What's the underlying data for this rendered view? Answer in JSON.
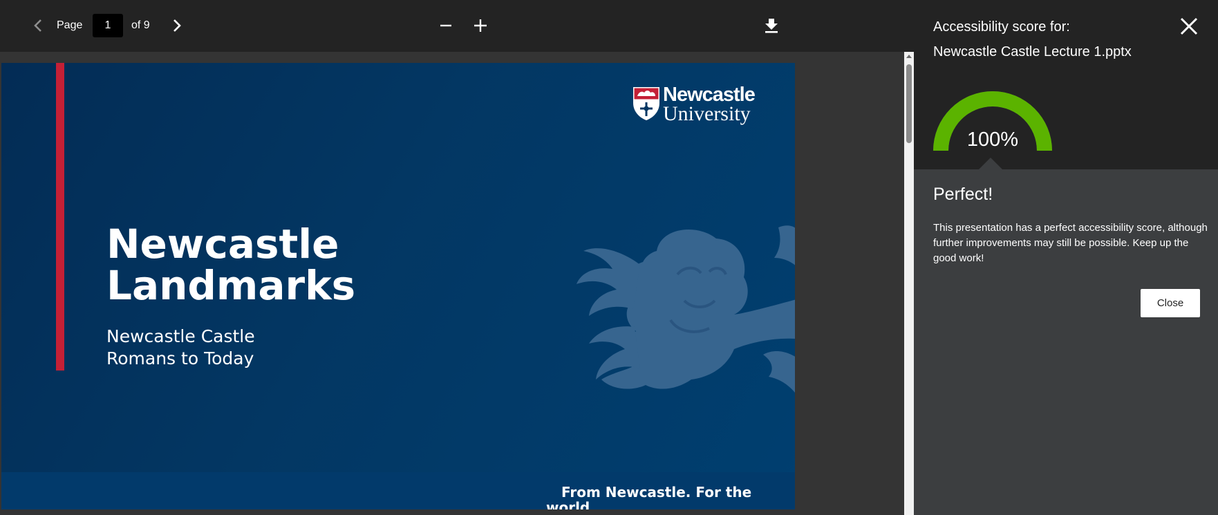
{
  "viewer": {
    "toolbar": {
      "prev_icon": "chevron-left-icon",
      "page_label": "Page",
      "page_value": "1",
      "of_label": "of 9",
      "next_icon": "chevron-right-icon",
      "zoom_out_icon": "minus-icon",
      "zoom_in_icon": "plus-icon",
      "download_icon": "download-icon"
    },
    "slide": {
      "logo_line1": "Newcastle",
      "logo_line2": "University",
      "title": "Newcastle\nLandmarks",
      "subtitle": "Newcastle Castle\nRomans to Today",
      "tagline": "From Newcastle. For the world."
    }
  },
  "panel": {
    "heading": "Accessibility score for:",
    "filename": "Newcastle Castle Lecture 1.pptx",
    "score": "100%",
    "score_fraction": 1.0,
    "result_title": "Perfect!",
    "result_body": "This presentation has a perfect accessibility score, although further improvements may still be possible. Keep up the good work!",
    "close_label": "Close",
    "close_icon": "close-icon"
  },
  "colors": {
    "gauge_fill": "#5bb300",
    "slide_accent": "#c42036",
    "slide_background": "#033763"
  }
}
